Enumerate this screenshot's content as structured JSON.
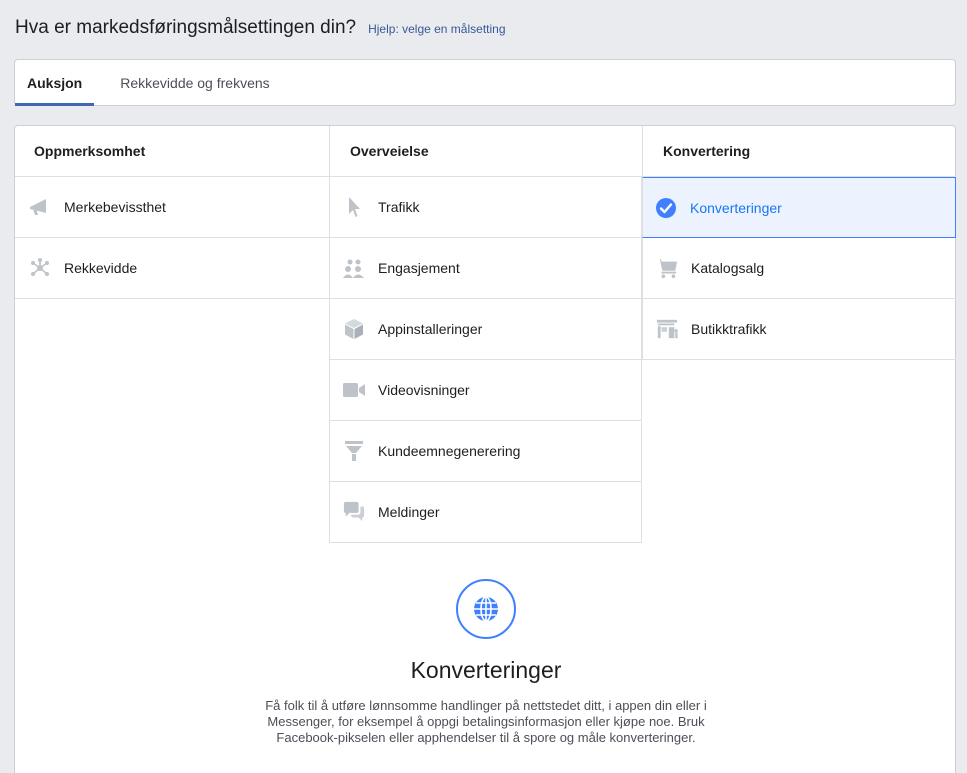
{
  "header": {
    "question": "Hva er markedsføringsmålsettingen din?",
    "help_link": "Hjelp: velge en målsetting"
  },
  "tabs": [
    {
      "label": "Auksjon",
      "active": true
    },
    {
      "label": "Rekkevidde og frekvens",
      "active": false
    }
  ],
  "columns": {
    "awareness": {
      "title": "Oppmerksomhet",
      "items": [
        {
          "label": "Merkebevissthet",
          "icon": "megaphone-icon"
        },
        {
          "label": "Rekkevidde",
          "icon": "network-icon"
        }
      ]
    },
    "consideration": {
      "title": "Overveielse",
      "items": [
        {
          "label": "Trafikk",
          "icon": "cursor-icon"
        },
        {
          "label": "Engasjement",
          "icon": "people-icon"
        },
        {
          "label": "Appinstalleringer",
          "icon": "box-icon"
        },
        {
          "label": "Videovisninger",
          "icon": "video-camera-icon"
        },
        {
          "label": "Kundeemnegenerering",
          "icon": "funnel-icon"
        },
        {
          "label": "Meldinger",
          "icon": "chat-bubbles-icon"
        }
      ]
    },
    "conversion": {
      "title": "Konvertering",
      "items": [
        {
          "label": "Konverteringer",
          "icon": "checkmark-circle-icon",
          "selected": true
        },
        {
          "label": "Katalogsalg",
          "icon": "shopping-cart-icon"
        },
        {
          "label": "Butikktrafikk",
          "icon": "store-icon"
        }
      ]
    }
  },
  "detail": {
    "icon": "globe-icon",
    "title": "Konverteringer",
    "description": "Få folk til å utføre lønnsomme handlinger på nettstedet ditt, i appen din eller i Messenger, for eksempel å oppgi betalingsinformasjon eller kjøpe noe. Bruk Facebook-pikselen eller apphendelser til å spore og måle konverteringer."
  },
  "colors": {
    "accent": "#4080ff",
    "selected_bg": "#ecf3ff",
    "icon_gray": "#bec3c9"
  }
}
